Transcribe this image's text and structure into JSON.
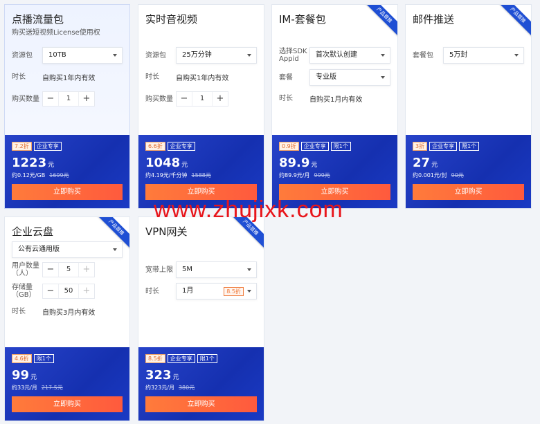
{
  "ribbon_label": "产品首推",
  "watermark": "www.zhujixk.com",
  "cards": {
    "live": {
      "title": "点播流量包",
      "subtitle": "购买送短视频License使用权",
      "resource_label": "资源包",
      "resource_value": "10TB",
      "duration_label": "时长",
      "duration_value": "自购买1年内有效",
      "qty_label": "购买数量",
      "qty_value": "1",
      "minus": "−",
      "plus": "+",
      "discount": "7.2折",
      "badge_enterprise": "企业专享",
      "price": "1223",
      "price_unit": "元",
      "unit_price": "约0.12元/GB",
      "original": "1699元",
      "buy": "立即购买"
    },
    "rtc": {
      "title": "实时音视频",
      "resource_label": "资源包",
      "resource_value": "25万分钟",
      "duration_label": "时长",
      "duration_value": "自购买1年内有效",
      "qty_label": "购买数量",
      "qty_value": "1",
      "minus": "−",
      "plus": "+",
      "discount": "6.6折",
      "badge_enterprise": "企业专享",
      "price": "1048",
      "price_unit": "元",
      "unit_price": "约4.19元/千分钟",
      "original": "1588元",
      "buy": "立即购买"
    },
    "im": {
      "title": "IM-套餐包",
      "sdk_label": "选择SDK Appid",
      "sdk_value": "首次默认创建",
      "plan_label": "套餐",
      "plan_value": "专业版",
      "duration_label": "时长",
      "duration_value": "自购买1月内有效",
      "discount": "0.9折",
      "badge_enterprise": "企业专享",
      "badge_limit": "限1个",
      "price": "89.9",
      "price_unit": "元",
      "unit_price": "约89.9元/月",
      "original": "999元",
      "buy": "立即购买"
    },
    "mail": {
      "title": "邮件推送",
      "pkg_label": "套餐包",
      "pkg_value": "5万封",
      "discount": "3折",
      "badge_enterprise": "企业专享",
      "badge_limit": "限1个",
      "price": "27",
      "price_unit": "元",
      "unit_price": "约0.001元/封",
      "original": "90元",
      "buy": "立即购买"
    },
    "disk": {
      "title": "企业云盘",
      "edition_value": "公有云通用版",
      "users_label": "用户数量（人）",
      "users_value": "5",
      "storage_label": "存储量（GB）",
      "storage_value": "50",
      "minus": "−",
      "plus": "+",
      "duration_label": "时长",
      "duration_value": "自购买3月内有效",
      "discount": "4.6折",
      "badge_limit": "限1个",
      "price": "99",
      "price_unit": "元",
      "unit_price": "约33元/月",
      "original": "217.5元",
      "buy": "立即购买"
    },
    "vpn": {
      "title": "VPN网关",
      "bw_label": "宽带上限",
      "bw_value": "5M",
      "duration_label": "时长",
      "duration_value": "1月",
      "duration_tag": "8.5折",
      "discount": "8.5折",
      "badge_enterprise": "企业专享",
      "badge_limit": "限1个",
      "price": "323",
      "price_unit": "元",
      "unit_price": "约323元/月",
      "original": "380元",
      "buy": "立即购买"
    }
  }
}
